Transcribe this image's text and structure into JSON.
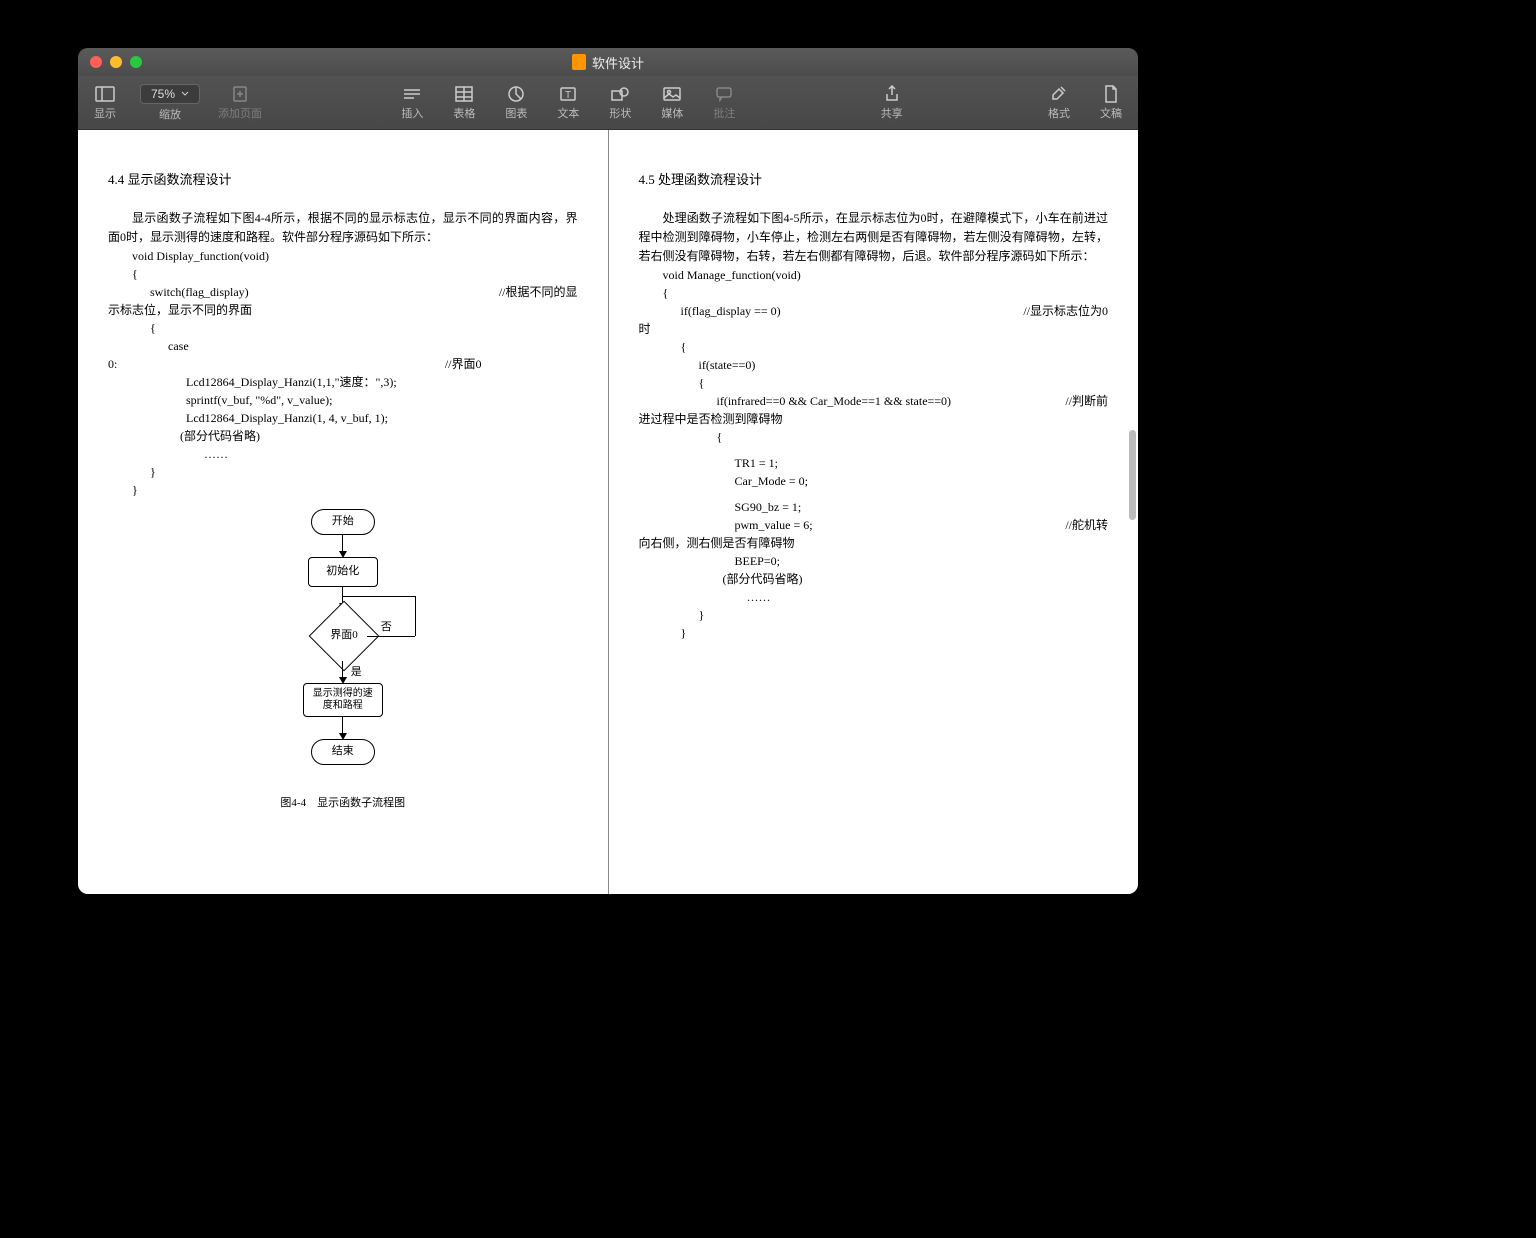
{
  "window": {
    "title": "软件设计"
  },
  "toolbar": {
    "show": "显示",
    "zoom_value": "75%",
    "zoom_label": "缩放",
    "add_page": "添加页面",
    "insert": "插入",
    "table": "表格",
    "chart": "图表",
    "text": "文本",
    "shape": "形状",
    "media": "媒体",
    "comment": "批注",
    "share": "共享",
    "format": "格式",
    "document": "文稿"
  },
  "left": {
    "heading": "4.4 显示函数流程设计",
    "p1": "显示函数子流程如下图4-4所示，根据不同的显示标志位，显示不同的界面内容，界面0时，显示测得的速度和路程。软件部分程序源码如下所示：",
    "c1": "void Display_function(void)",
    "c2": "{",
    "c3": "switch(flag_display)",
    "c3_comment": "//根据不同的显",
    "c3b": "示标志位，显示不同的界面",
    "c4": "{",
    "c5": "case",
    "c6": "0:",
    "c6_comment": "//界面0",
    "c7": "Lcd12864_Display_Hanzi(1,1,\"速度：\",3);",
    "c8": "sprintf(v_buf, \"%d\", v_value);",
    "c9": "Lcd12864_Display_Hanzi(1, 4, v_buf, 1);",
    "c10": "(部分代码省略)",
    "c11": "……",
    "c12": "}",
    "c13": "}",
    "fc_start": "开始",
    "fc_init": "初始化",
    "fc_cond": "界面0",
    "fc_no": "否",
    "fc_yes": "是",
    "fc_disp": "显示测得的速度和路程",
    "fc_end": "结束",
    "caption": "图4-4　显示函数子流程图"
  },
  "right": {
    "heading": "4.5 处理函数流程设计",
    "p1": "处理函数子流程如下图4-5所示，在显示标志位为0时，在避障模式下，小车在前进过程中检测到障碍物，小车停止，检测左右两侧是否有障碍物，若左侧没有障碍物，左转，若右侧没有障碍物，右转，若左右侧都有障碍物，后退。软件部分程序源码如下所示：",
    "c1": "void Manage_function(void)",
    "c2": "{",
    "c3": "if(flag_display == 0)",
    "c3_comment": "//显示标志位为0",
    "c3b": "时",
    "c4": "{",
    "c5": "if(state==0)",
    "c6": "{",
    "c7": "if(infrared==0 && Car_Mode==1 && state==0)",
    "c7_comment": "//判断前",
    "c7b": "进过程中是否检测到障碍物",
    "c8": "{",
    "c9": "TR1 = 1;",
    "c10": "Car_Mode = 0;",
    "c11": "SG90_bz = 1;",
    "c12": "pwm_value = 6;",
    "c12_comment": "//舵机转",
    "c12b": "向右侧，测右侧是否有障碍物",
    "c13": "BEEP=0;",
    "c14": "(部分代码省略)",
    "c15": "……",
    "c16": "}",
    "c17": "}"
  }
}
